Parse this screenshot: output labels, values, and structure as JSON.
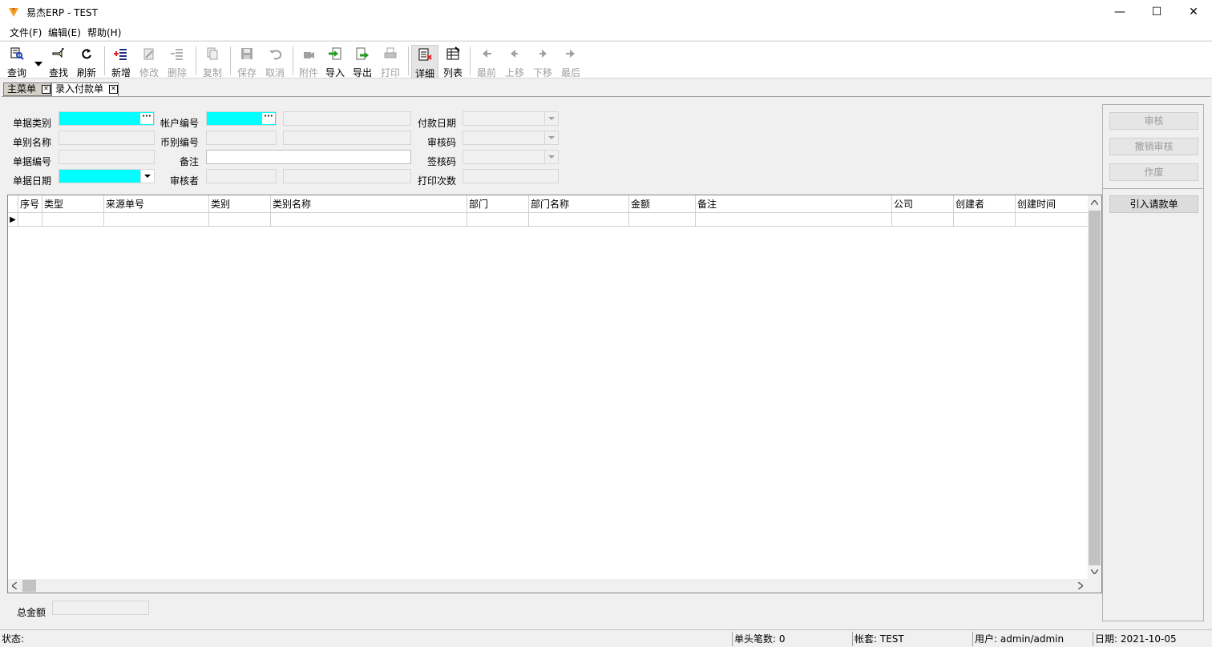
{
  "window": {
    "title": "易杰ERP - TEST",
    "minimize_glyph": "—",
    "maximize_glyph": "☐",
    "close_glyph": "✕"
  },
  "menu": [
    "文件(F)",
    "编辑(E)",
    "帮助(H)"
  ],
  "toolbar": {
    "query": "查询",
    "find": "查找",
    "refresh": "刷新",
    "new": "新增",
    "edit": "修改",
    "delete": "删除",
    "copy": "复制",
    "save": "保存",
    "cancel": "取消",
    "attach": "附件",
    "import": "导入",
    "export": "导出",
    "print": "打印",
    "detail": "详细",
    "list": "列表",
    "first": "最前",
    "up": "上移",
    "down": "下移",
    "last": "最后"
  },
  "tabs": [
    "主菜单",
    "录入付款单"
  ],
  "form": {
    "doc_type_label": "单据类别",
    "doc_name_label": "单别名称",
    "doc_no_label": "单据编号",
    "doc_date_label": "单据日期",
    "account_no_label": "帐户编号",
    "currency_no_label": "币别编号",
    "remark_label": "备注",
    "auditor_label": "审核者",
    "pay_date_label": "付款日期",
    "audit_code_label": "审核码",
    "sign_code_label": "签核码",
    "print_count_label": "打印次数",
    "ellipsis": "···"
  },
  "grid": {
    "columns": [
      "序号",
      "类型",
      "来源单号",
      "类别",
      "类别名称",
      "部门",
      "部门名称",
      "金额",
      "备注",
      "公司",
      "创建者",
      "创建时间"
    ],
    "current_row_marker": "▶"
  },
  "total": {
    "label": "总金额"
  },
  "side_buttons": {
    "audit": "审核",
    "unaudit": "撤销审核",
    "void": "作废",
    "import_request": "引入请款单"
  },
  "status": {
    "state": "状态:",
    "header_count": "单头笔数: 0",
    "account_set": "帐套: TEST",
    "user": "用户: admin/admin",
    "date": "日期: 2021-10-05"
  }
}
